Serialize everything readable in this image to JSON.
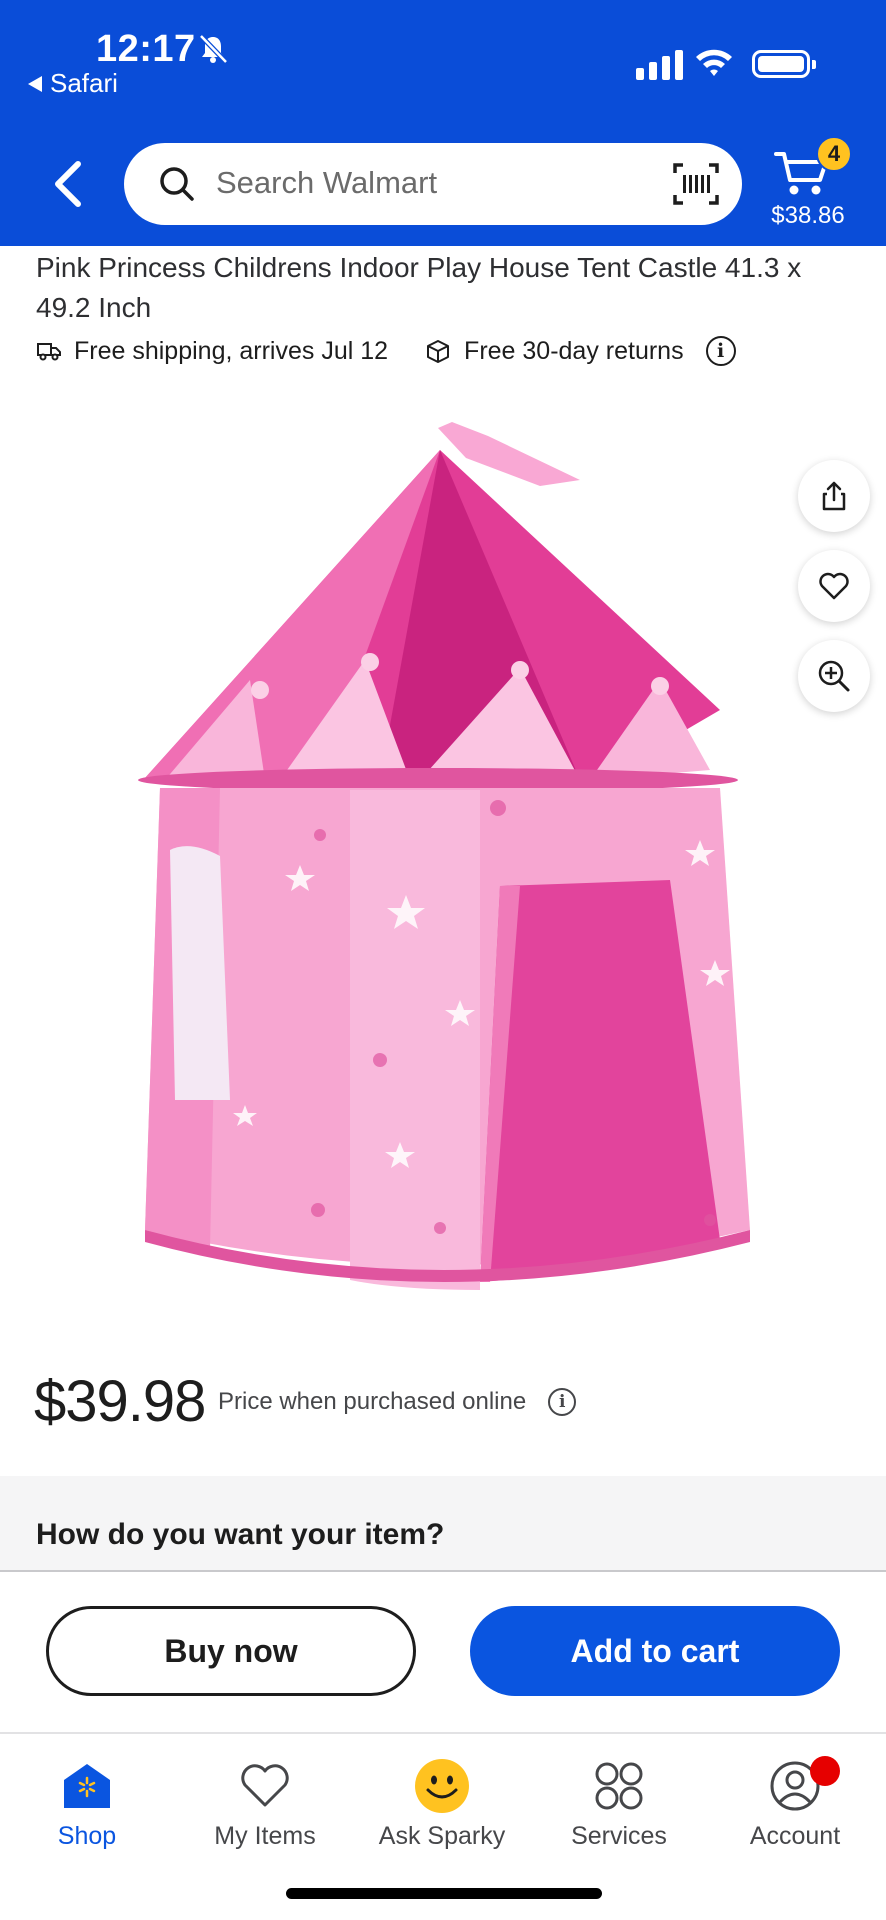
{
  "status_bar": {
    "time": "12:17",
    "back_app": "Safari"
  },
  "header": {
    "search_placeholder": "Search Walmart",
    "cart_count": "4",
    "cart_total": "$38.86"
  },
  "product": {
    "title": "Pink Princess Childrens Indoor Play House Tent Castle 41.3 x 49.2 Inch",
    "shipping": "Free shipping, arrives Jul 12",
    "returns": "Free 30-day returns",
    "price": "$39.98",
    "price_note": "Price when purchased online"
  },
  "fulfillment": {
    "title": "How do you want your item?"
  },
  "actions": {
    "buy_now": "Buy now",
    "add_to_cart": "Add to cart"
  },
  "bottom_nav": {
    "items": [
      {
        "label": "Shop",
        "icon": "shop-icon"
      },
      {
        "label": "My Items",
        "icon": "heart-icon"
      },
      {
        "label": "Ask Sparky",
        "icon": "sparky-icon"
      },
      {
        "label": "Services",
        "icon": "services-icon"
      },
      {
        "label": "Account",
        "icon": "account-icon"
      }
    ]
  },
  "colors": {
    "brand_blue": "#0a4dd8",
    "spark_yellow": "#ffc220",
    "button_blue": "#0a55e0",
    "tent_pink": "#f48cc8"
  }
}
